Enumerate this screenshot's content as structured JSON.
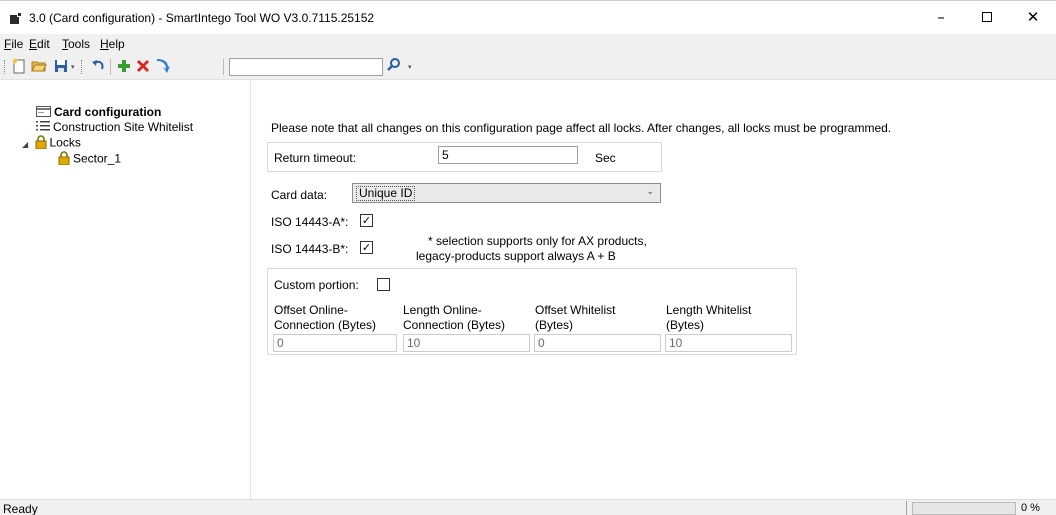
{
  "window": {
    "title": "3.0 (Card configuration) - SmartIntego Tool WO V3.0.7115.25152",
    "minimize": "–",
    "maximize": "",
    "close": "✕"
  },
  "menu": {
    "file": "ile",
    "file_key": "F",
    "edit": "dit",
    "edit_key": "E",
    "tools": "ools",
    "tools_key": "T",
    "help": "elp",
    "help_key": "H"
  },
  "toolbar": {
    "search_value": "",
    "icons": [
      "new-icon",
      "open-folder-icon",
      "save-icon",
      "undo-icon",
      "add-icon",
      "delete-icon",
      "arrow-icon",
      "search-icon"
    ]
  },
  "tree": {
    "items": [
      {
        "label": "Card configuration",
        "icon": "card-icon",
        "bold": true
      },
      {
        "label": "Construction Site Whitelist",
        "icon": "list-icon"
      },
      {
        "label": "Locks",
        "icon": "lock-icon",
        "expander": "◢"
      },
      {
        "label": "Sector_1",
        "icon": "lock-icon"
      }
    ]
  },
  "content": {
    "notice": "Please note that all changes on this configuration page affect all locks. After changes, all locks must be programmed.",
    "return_timeout": {
      "label": "Return timeout:",
      "value": "5",
      "unit": "Sec"
    },
    "card_data": {
      "label": "Card data:",
      "value": "Unique ID"
    },
    "iso_a": {
      "label": "ISO 14443-A*:",
      "checked": "✓"
    },
    "iso_b": {
      "label": "ISO 14443-B*:",
      "checked": "✓"
    },
    "iso_note_line1": "* selection supports only for AX products,",
    "iso_note_line2": "legacy-products support always A + B",
    "custom_portion": {
      "label": "Custom portion:",
      "checked": "",
      "columns": [
        {
          "line1": "Offset Online-",
          "line2": "Connection (Bytes)",
          "value": "0"
        },
        {
          "line1": "Length Online-",
          "line2": "Connection (Bytes)",
          "value": "10"
        },
        {
          "line1": "Offset Whitelist",
          "line2": "(Bytes)",
          "value": "0"
        },
        {
          "line1": "Length Whitelist",
          "line2": "(Bytes)",
          "value": "10"
        }
      ]
    }
  },
  "status": {
    "text": "Ready",
    "progress_fraction": 0,
    "progress_text": "0 %"
  },
  "colors": {
    "menu_bg": "#f0f0f0",
    "progress_fill": "#06b025",
    "lock_yellow": "#e0a800",
    "delete_red": "#d9251d",
    "add_green": "#3a9c2f",
    "accent_blue": "#1f5fa8"
  }
}
